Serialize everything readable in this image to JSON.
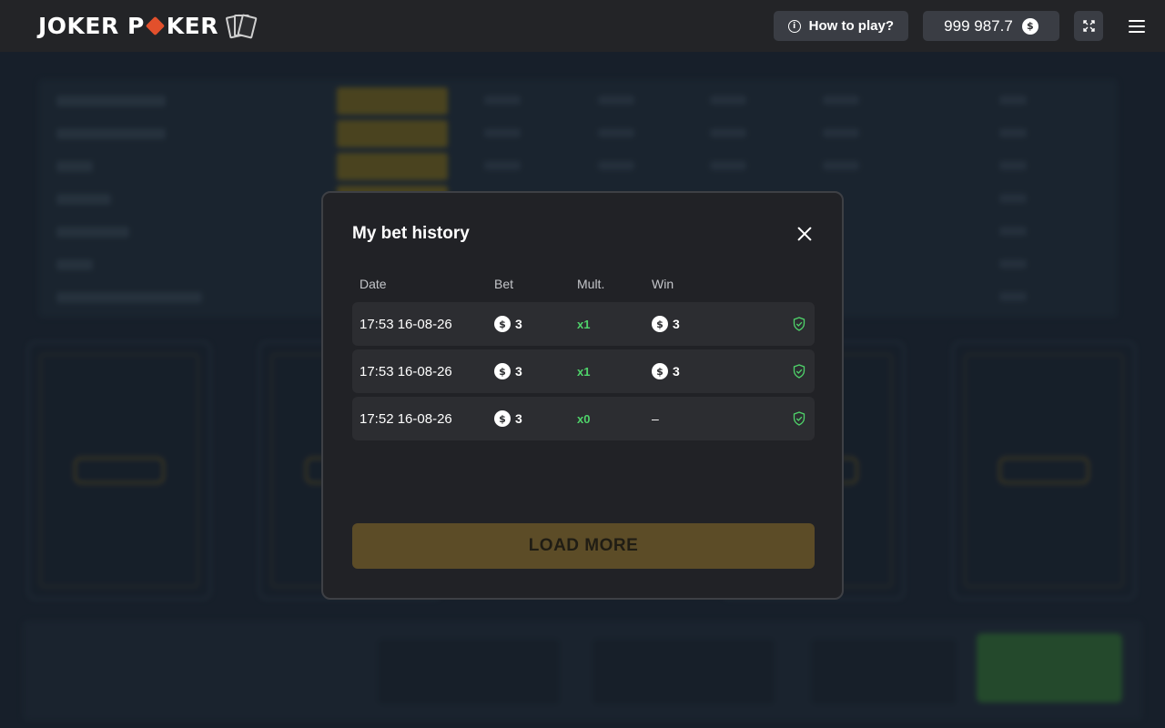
{
  "header": {
    "logo_left": "JOKER P",
    "logo_right": "KER",
    "how_to_play": "How to play?",
    "balance": "999 987.7",
    "currency_symbol": "$"
  },
  "modal": {
    "title": "My bet history",
    "columns": {
      "date": "Date",
      "bet": "Bet",
      "mult": "Mult.",
      "win": "Win"
    },
    "rows": [
      {
        "date": "17:53 16-08-26",
        "bet": "3",
        "mult": "x1",
        "win": "3"
      },
      {
        "date": "17:53 16-08-26",
        "bet": "3",
        "mult": "x1",
        "win": "3"
      },
      {
        "date": "17:52 16-08-26",
        "bet": "3",
        "mult": "x0",
        "win": "–"
      }
    ],
    "load_more": "LOAD MORE"
  },
  "colors": {
    "accent_gold": "#5c4c27",
    "win_green": "#4fd36a",
    "logo_red": "#e2502c"
  },
  "icons": {
    "info": "info-icon",
    "coin": "coin-icon",
    "fullscreen": "fullscreen-icon",
    "menu": "menu-icon",
    "close": "close-icon",
    "verified": "shield-check-icon"
  }
}
